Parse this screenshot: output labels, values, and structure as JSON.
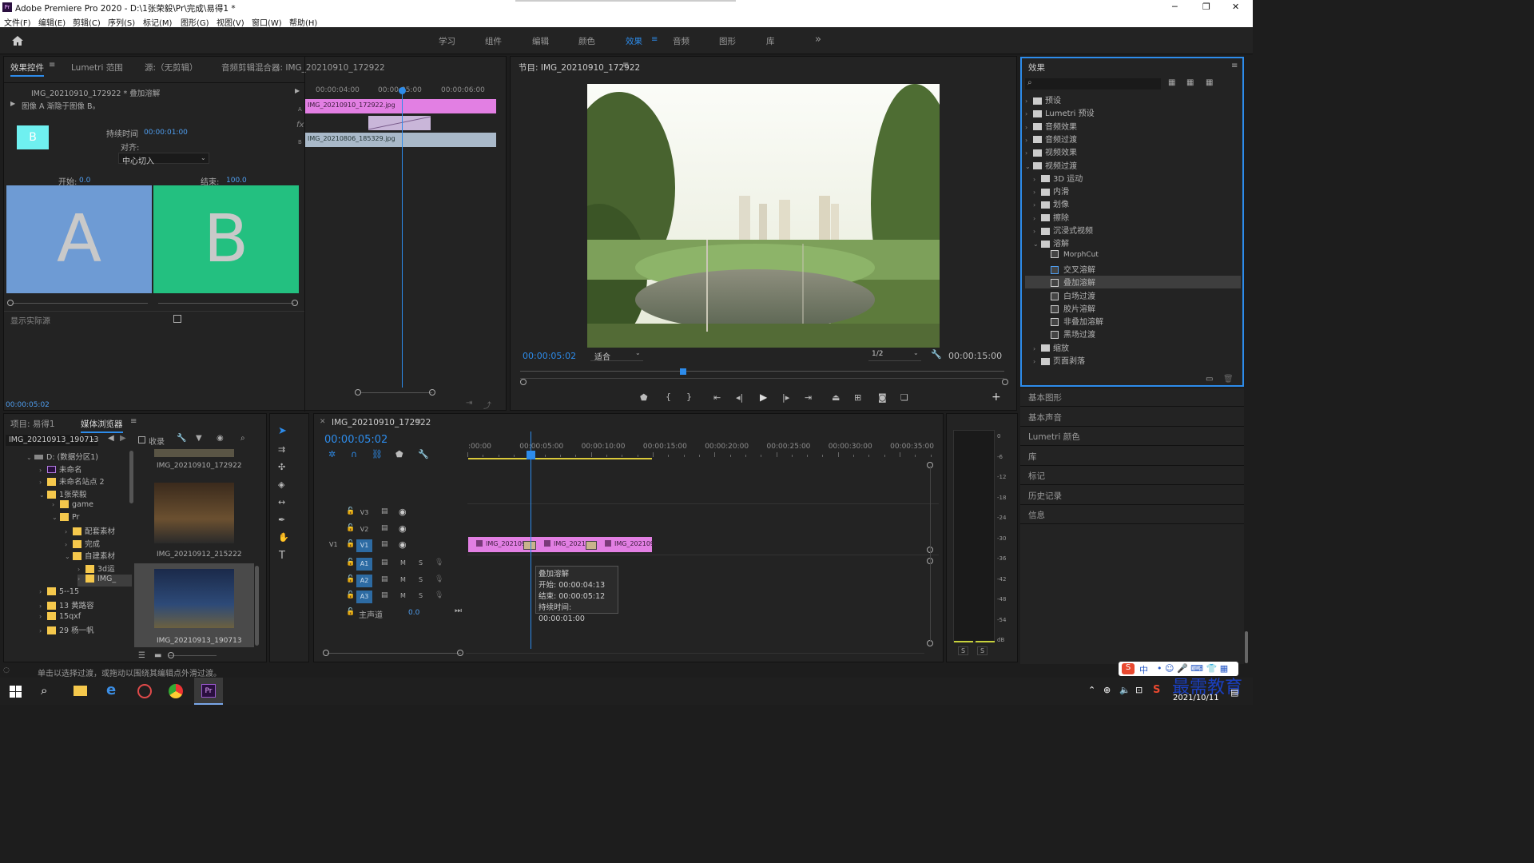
{
  "app": {
    "title": "Adobe Premiere Pro 2020 - D:\\1张荣毅\\Pr\\完成\\易得1 *",
    "minimize": "─",
    "restore": "❐",
    "close": "✕"
  },
  "menu": [
    "文件(F)",
    "编辑(E)",
    "剪辑(C)",
    "序列(S)",
    "标记(M)",
    "图形(G)",
    "视图(V)",
    "窗口(W)",
    "帮助(H)"
  ],
  "workspace": {
    "tabs": [
      "学习",
      "组件",
      "编辑",
      "颜色",
      "效果",
      "音频",
      "图形",
      "库"
    ],
    "active": "效果",
    "more": "»"
  },
  "effect_controls": {
    "tabs": [
      "效果控件",
      "Lumetri 范围",
      "源:（无剪辑）",
      "音频剪辑混合器: IMG_20210910_172922"
    ],
    "clip_path": "IMG_20210910_172922 * 叠加溶解",
    "description": "图像 A 渐隐于图像 B。",
    "b_label": "B",
    "duration_label": "持续时间",
    "duration_value": "00:00:01:00",
    "align_label": "对齐:",
    "align_value": "中心切入",
    "start_label": "开始:",
    "start_value": "0.0",
    "end_label": "结束:",
    "end_value": "100.0",
    "a_big": "A",
    "b_big": "B",
    "show_source": "显示实际源",
    "timecode": "00:00:05:02",
    "ruler": [
      "00:00:04:00",
      "00:00:05:00",
      "00:00:06:00"
    ],
    "clip_a": "IMG_20210910_172922.jpg",
    "clip_b": "IMG_20210806_185329.jpg",
    "track_a": "A",
    "track_b": "B",
    "fx": "fx"
  },
  "program": {
    "title": "节目: IMG_20210910_172922",
    "timecode": "00:00:05:02",
    "fit": "适合",
    "quality": "1/2",
    "duration": "00:00:15:00"
  },
  "effects": {
    "title": "效果",
    "items": [
      {
        "label": "预设",
        "level": 0,
        "open": false
      },
      {
        "label": "Lumetri 预设",
        "level": 0,
        "open": false
      },
      {
        "label": "音频效果",
        "level": 0,
        "open": false
      },
      {
        "label": "音频过渡",
        "level": 0,
        "open": false
      },
      {
        "label": "视频效果",
        "level": 0,
        "open": false
      },
      {
        "label": "视频过渡",
        "level": 0,
        "open": true
      },
      {
        "label": "3D 运动",
        "level": 1,
        "open": false
      },
      {
        "label": "内滑",
        "level": 1,
        "open": false
      },
      {
        "label": "划像",
        "level": 1,
        "open": false
      },
      {
        "label": "擦除",
        "level": 1,
        "open": false
      },
      {
        "label": "沉浸式视频",
        "level": 1,
        "open": false
      },
      {
        "label": "溶解",
        "level": 1,
        "open": true
      }
    ],
    "dissolves": [
      "MorphCut",
      "交叉溶解",
      "叠加溶解",
      "白场过渡",
      "胶片溶解",
      "非叠加溶解",
      "黑场过渡"
    ],
    "after": [
      "缩放",
      "页面剥落"
    ],
    "side_panels": [
      "基本图形",
      "基本声音",
      "Lumetri 颜色",
      "库",
      "标记",
      "历史记录",
      "信息"
    ]
  },
  "project": {
    "tabs": [
      "项目: 易得1",
      "媒体浏览器"
    ],
    "path": "IMG_20210913_190713",
    "ingest": "收录",
    "tree": [
      {
        "label": "D: (数据分区1)",
        "level": 0,
        "type": "drive"
      },
      {
        "label": "未命名",
        "level": 1,
        "type": "pr"
      },
      {
        "label": "未命名站点 2",
        "level": 1,
        "type": "y"
      },
      {
        "label": "1张荣毅",
        "level": 1,
        "type": "y"
      },
      {
        "label": "game",
        "level": 2,
        "type": "y"
      },
      {
        "label": "Pr",
        "level": 2,
        "type": "y"
      },
      {
        "label": "配套素材",
        "level": 3,
        "type": "y"
      },
      {
        "label": "完成",
        "level": 3,
        "type": "y"
      },
      {
        "label": "自建素材",
        "level": 3,
        "type": "y"
      },
      {
        "label": "3d运",
        "level": 4,
        "type": "y"
      },
      {
        "label": "IMG_",
        "level": 4,
        "type": "y"
      },
      {
        "label": "5--15",
        "level": 1,
        "type": "y"
      },
      {
        "label": "13 黄路容",
        "level": 1,
        "type": "y"
      },
      {
        "label": "15qxf",
        "level": 1,
        "type": "y"
      },
      {
        "label": "29 杨一帆",
        "level": 1,
        "type": "y"
      }
    ],
    "thumbs": [
      "IMG_20210910_172922",
      "IMG_20210912_215222",
      "IMG_20210913_190713"
    ]
  },
  "timeline": {
    "title": "IMG_20210910_172922",
    "timecode": "00:00:05:02",
    "ruler": [
      ":00:00",
      "00:00:05:00",
      "00:00:10:00",
      "00:00:15:00",
      "00:00:20:00",
      "00:00:25:00",
      "00:00:30:00",
      "00:00:35:00"
    ],
    "video_tracks": [
      "V3",
      "V2",
      "V1"
    ],
    "audio_tracks": [
      "A1",
      "A2",
      "A3"
    ],
    "master_label": "主声道",
    "master_value": "0.0",
    "clips": [
      "IMG_202109",
      "IMG_2021",
      "IMG_202109"
    ],
    "tooltip": {
      "title": "叠加溶解",
      "start": "开始: 00:00:04:13",
      "end": "结束: 00:00:05:12",
      "duration": "持续时间: 00:00:01:00"
    }
  },
  "meter": {
    "scale": [
      "0",
      "-6",
      "-12",
      "-18",
      "-24",
      "-30",
      "-36",
      "-42",
      "-48",
      "-54",
      "dB"
    ],
    "solo": [
      "S",
      "S"
    ]
  },
  "status": "单击以选择过渡，或拖动以围绕其编辑点外滑过渡。",
  "taskbar": {
    "date": "2021/10/11",
    "ime": "中",
    "watermark": "最需教育"
  },
  "colors": {
    "accent": "#2d8ceb",
    "clip": "#e27fe3",
    "clip_b": "#a9b9c9",
    "a_panel": "#6e9bd4",
    "b_panel": "#23c080"
  }
}
